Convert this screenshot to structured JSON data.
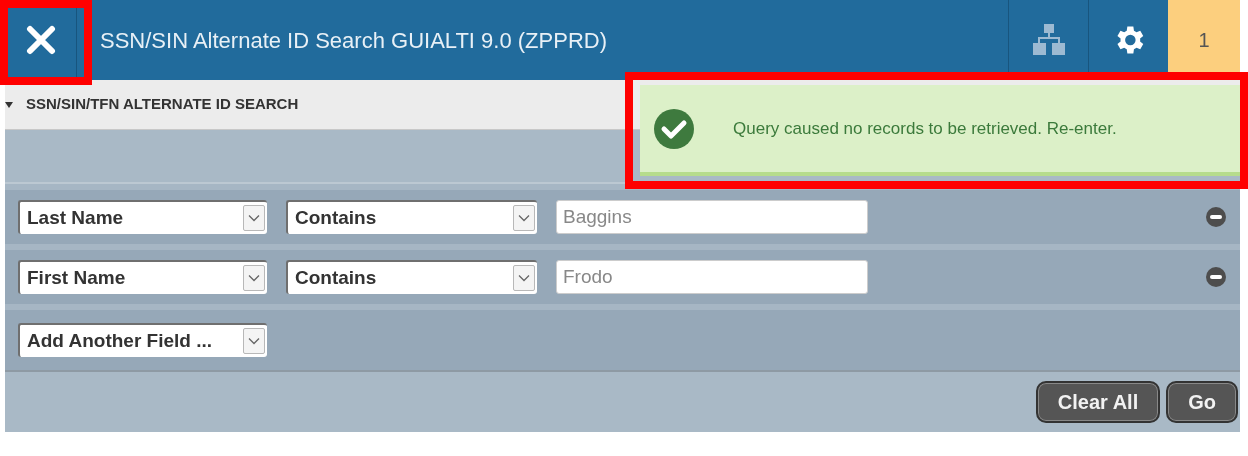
{
  "close_button": {
    "highlighted": true
  },
  "header": {
    "title": "SSN/SIN Alternate ID Search GUIALTI 9.0 (ZPPRD)",
    "notification_count": "1"
  },
  "section": {
    "title": "SSN/SIN/TFN ALTERNATE ID SEARCH",
    "expanded": true
  },
  "criteria": [
    {
      "field": "Last Name",
      "operator": "Contains",
      "value": "Baggins"
    },
    {
      "field": "First Name",
      "operator": "Contains",
      "value": "Frodo"
    }
  ],
  "add_field": "Add Another Field ...",
  "buttons": [
    "Clear All",
    "Go"
  ],
  "notification": {
    "kind": "success",
    "message": "Query caused no records to be retrieved. Re-enter.",
    "highlighted": true
  }
}
